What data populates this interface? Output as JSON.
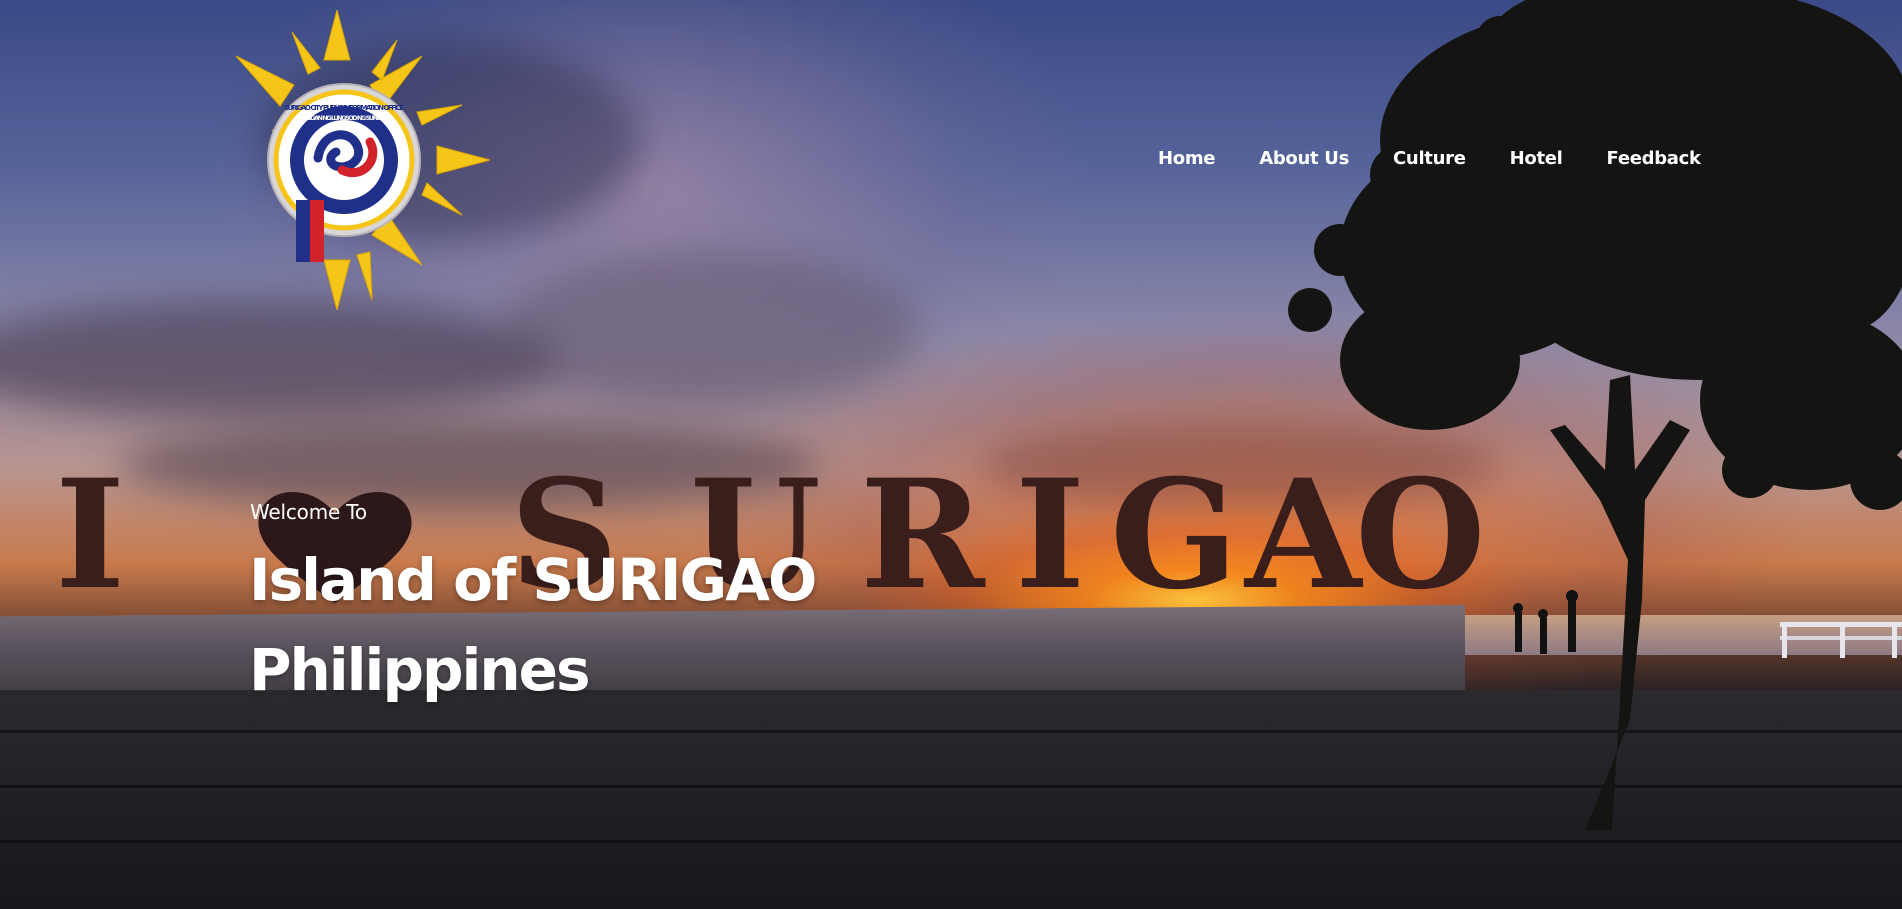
{
  "logo": {
    "arc_text": "SURIGAO CITY PUBLIC INFORMATION OFFICE",
    "ring_text": "SIGSIGAN NG LUNGSOD NG SURIGAO",
    "bottom_text": "PILIPINAS"
  },
  "nav": {
    "items": [
      "Home",
      "About Us",
      "Culture",
      "Hotel",
      "Feedback"
    ]
  },
  "hero": {
    "welcome": "Welcome To",
    "title_line1": "Island of SURIGAO",
    "title_line2": "Philippines",
    "sign_letters": [
      "I",
      "S",
      "U",
      "R",
      "I",
      "G",
      "A",
      "O"
    ]
  },
  "colors": {
    "sun_yellow": "#f5c518",
    "seal_blue": "#1f2f8a",
    "seal_red": "#d2232a",
    "text_white": "#ffffff"
  }
}
